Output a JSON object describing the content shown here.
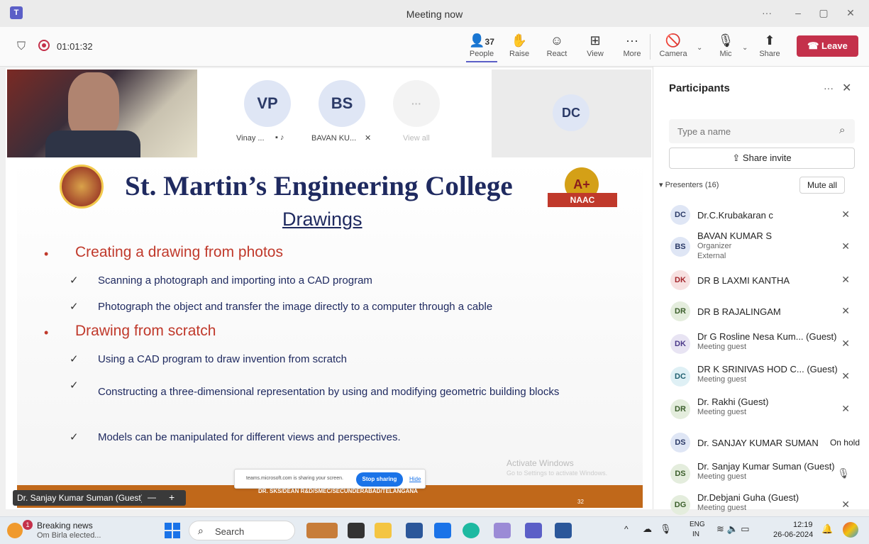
{
  "window": {
    "title": "Meeting now",
    "ellipsis": "···",
    "minimize": "–",
    "restore": "▢",
    "close": "✕"
  },
  "toolbar": {
    "timer": "01:01:32",
    "people_count": "37",
    "people": "People",
    "raise": "Raise",
    "react": "React",
    "view": "View",
    "more": "More",
    "camera": "Camera",
    "mic": "Mic",
    "share": "Share",
    "leave": "Leave"
  },
  "strip": {
    "tiles": [
      {
        "initials": "VP",
        "name": "Vinay ...",
        "color": "#dfe6f5"
      },
      {
        "initials": "BS",
        "name": "BAVAN KU...",
        "color": "#dfe6f5"
      },
      {
        "initials": "···",
        "name": "View all",
        "color": "#f0f0f0"
      }
    ],
    "dc": {
      "initials": "DC",
      "color": "#e6ecf7"
    }
  },
  "slide": {
    "college": "St. Martin’s Engineering College",
    "subtitle": "Drawings",
    "naac_grade": "A+",
    "naac_label": "NAAC",
    "bullets": [
      {
        "text": "Creating a drawing from photos",
        "items": [
          "Scanning a photograph and importing into a CAD program",
          "Photograph the object and transfer the image directly to a computer through a cable"
        ]
      },
      {
        "text": "Drawing from scratch",
        "items": [
          "Using a CAD program to draw invention from scratch",
          "Constructing a three-dimensional representation by using and modifying geometric building blocks",
          "Models can be manipulated for different views and perspectives."
        ]
      }
    ],
    "footer": "DR. SKS/DEAN R&D/SMEC/SECUNDERABAD/TELANGANA",
    "page": "32",
    "activate_title": "Activate Windows",
    "activate_sub": "Go to Settings to activate Windows."
  },
  "share_bar": {
    "text": "teams.microsoft.com is sharing your screen.",
    "stop": "Stop sharing",
    "hide": "Hide"
  },
  "presenter_label": "Dr. Sanjay Kumar Suman (Guest)",
  "zoom": {
    "minus": "—",
    "plus": "+"
  },
  "panel": {
    "title": "Participants",
    "search_placeholder": "Type a name",
    "share_invite": "Share invite",
    "section": "Presenters (16)",
    "mute_all": "Mute all",
    "people": [
      {
        "initials": "DC",
        "name": "Dr.C.Krubakaran c",
        "role": "",
        "role2": "",
        "bg": "#dfe6f5",
        "fg": "#2b3a67"
      },
      {
        "initials": "BS",
        "name": "BAVAN KUMAR S",
        "role": "Organizer",
        "role2": "External",
        "bg": "#dfe6f5",
        "fg": "#2b3a67"
      },
      {
        "initials": "DK",
        "name": "DR B LAXMI KANTHA",
        "role": "",
        "role2": "",
        "bg": "#f7e1e1",
        "fg": "#a4262c"
      },
      {
        "initials": "DR",
        "name": "DR B RAJALINGAM",
        "role": "",
        "role2": "",
        "bg": "#e4eddd",
        "fg": "#3b5e2b"
      },
      {
        "initials": "DK",
        "name": "Dr G Rosline Nesa Kum... (Guest)",
        "role": "Meeting guest",
        "role2": "",
        "bg": "#e8e4f3",
        "fg": "#4b3a8a"
      },
      {
        "initials": "DC",
        "name": "DR K SRINIVAS HOD C... (Guest)",
        "role": "Meeting guest",
        "role2": "",
        "bg": "#dff0f5",
        "fg": "#1f5f6f"
      },
      {
        "initials": "DR",
        "name": "Dr. Rakhi (Guest)",
        "role": "Meeting guest",
        "role2": "",
        "bg": "#e4eddd",
        "fg": "#3b5e2b"
      },
      {
        "initials": "DS",
        "name": "Dr. SANJAY KUMAR SUMAN",
        "role": "",
        "role2": "",
        "bg": "#dfe6f5",
        "fg": "#2b3a67",
        "status": "On hold"
      },
      {
        "initials": "DS",
        "name": "Dr. Sanjay Kumar Suman (Guest)",
        "role": "Meeting guest",
        "role2": "",
        "bg": "#e4eddd",
        "fg": "#3b5e2b"
      },
      {
        "initials": "DG",
        "name": "Dr.Debjani Guha (Guest)",
        "role": "Meeting guest",
        "role2": "",
        "bg": "#e4eddd",
        "fg": "#3b5e2b"
      }
    ]
  },
  "taskbar": {
    "news_badge": "1",
    "news_title": "Breaking news",
    "news_sub": "Om Birla elected...",
    "search": "Search",
    "lang1": "ENG",
    "lang2": "IN",
    "time": "12:19",
    "date": "26-06-2024"
  }
}
